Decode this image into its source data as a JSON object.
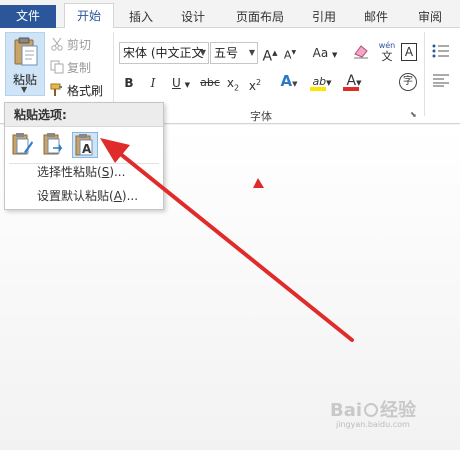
{
  "tabs": [
    {
      "label": "文件"
    },
    {
      "label": "开始"
    },
    {
      "label": "插入"
    },
    {
      "label": "设计"
    },
    {
      "label": "页面布局"
    },
    {
      "label": "引用"
    },
    {
      "label": "邮件"
    },
    {
      "label": "审阅"
    }
  ],
  "clipboard": {
    "paste_label": "粘贴",
    "cut_label": "剪切",
    "copy_label": "复制",
    "format_painter_label": "格式刷"
  },
  "font": {
    "font_name": "宋体 (中文正文",
    "font_size": "五号",
    "group_label": "字体",
    "phonetic_top": "wén",
    "phonetic_bottom": "文",
    "aa_label": "Aa",
    "bold": "B",
    "italic": "I",
    "underline": "U",
    "strike": "abc",
    "subscript_base": "x",
    "subscript_mark": "2",
    "superscript_base": "x",
    "superscript_mark": "2",
    "text_effect": "A",
    "highlight": "ab",
    "font_color": "A",
    "enclose_char": "字",
    "char_border": "A",
    "grow": "A",
    "shrink": "A"
  },
  "paste_menu": {
    "header": "粘贴选项:",
    "paste_special_label": "选择性粘贴(",
    "paste_special_key": "S",
    "paste_special_tail": ")...",
    "set_default_label": "设置默认粘贴(",
    "set_default_key": "A",
    "set_default_tail": ")..."
  },
  "watermark": {
    "brand": "Bai",
    "brand_tail": "经验",
    "domain": "jingyan.baidu.com"
  },
  "colors": {
    "file_tab": "#2b579a",
    "paste_selected": "#cfe4f6",
    "arrow": "#e02b2b",
    "highlight_bar": "#ffe600",
    "font_color_bar": "#e02b2b"
  }
}
